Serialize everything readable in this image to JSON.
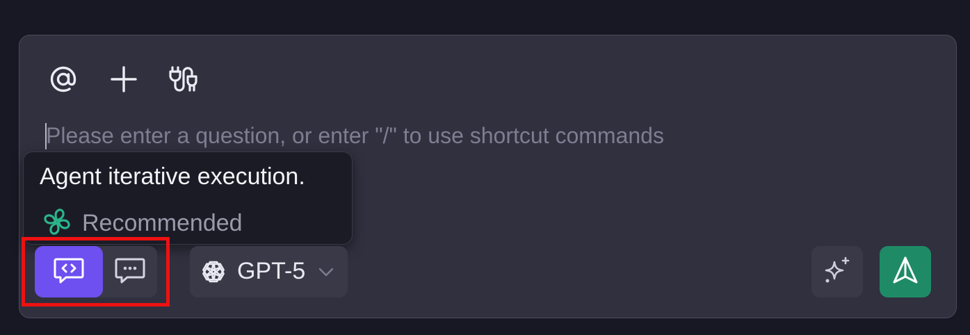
{
  "composer": {
    "toolbar": {
      "mention_icon": "at-sign-icon",
      "add_icon": "plus-icon",
      "plugin_icon": "plug-icon"
    },
    "input": {
      "value": "",
      "placeholder": "Please enter a question, or enter \"/\" to use shortcut commands"
    },
    "tooltip": {
      "title": "Agent iterative execution.",
      "badge_label": "Recommended",
      "badge_icon": "sparkle-flower-icon",
      "badge_color": "#2bb58a"
    },
    "mode_toggle": {
      "options": [
        {
          "icon": "code-chat-icon",
          "active": true
        },
        {
          "icon": "chat-dots-icon",
          "active": false
        }
      ],
      "active_color": "#6e4ff0"
    },
    "model_select": {
      "icon": "openai-logo-icon",
      "selected": "GPT-5"
    },
    "enhance_button": {
      "icon": "sparkles-icon"
    },
    "send_button": {
      "icon": "send-arrow-icon",
      "color": "#1f8b66"
    }
  }
}
